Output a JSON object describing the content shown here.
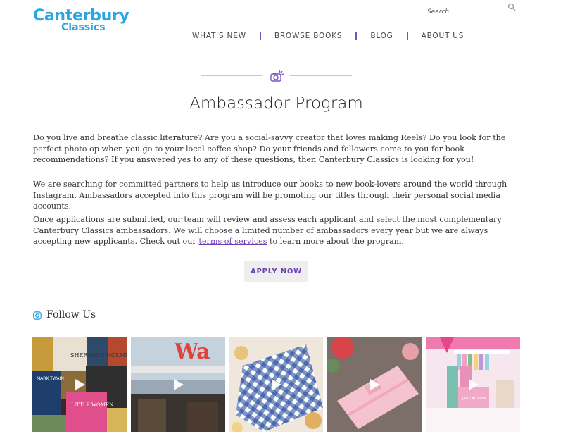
{
  "header": {
    "logo_line1": "Canterbury",
    "logo_line2": "Classics",
    "search_placeholder": "Search",
    "nav": [
      "WHAT'S NEW",
      "BROWSE BOOKS",
      "BLOG",
      "ABOUT US"
    ]
  },
  "main": {
    "title": "Ambassador Program",
    "paragraph1": "Do you live and breathe classic literature? Are you a social-savvy creator that loves making Reels? Do you look for the perfect photo op when you go to your local coffee shop? Do your friends and followers come to you for book recommendations? If you answered yes to any of these questions, then Canterbury Classics is looking for you!",
    "paragraph2": "We are searching for committed partners to help us introduce our books to new book-lovers around the world through Instagram. Ambassadors accepted into this program will be promoting our titles through their personal social media accounts.",
    "paragraph3_before": "Once applications are submitted, our team will review and assess each applicant and select the most complementary Canterbury Classics ambassadors. We will choose a limited number of ambassadors every year but we are always accepting new applicants. Check out our ",
    "paragraph3_link": "terms of services",
    "paragraph3_after": " to learn more about the program.",
    "apply_label": "APPLY NOW"
  },
  "follow": {
    "title": "Follow Us",
    "tiles": [
      {
        "name": "instagram-post-1",
        "book_labels": [
          "SHERLOCK HOLMES",
          "MARK TWAIN",
          "LITTLE WOMEN"
        ]
      },
      {
        "name": "instagram-post-2",
        "sign_text": "Wa"
      },
      {
        "name": "instagram-post-3"
      },
      {
        "name": "instagram-post-4"
      },
      {
        "name": "instagram-post-5",
        "book_label": "JANE AUSTEN"
      }
    ]
  },
  "colors": {
    "brand_blue": "#2aa7e0",
    "accent_purple": "#6c3fb5",
    "nav_separator": "#7a4fc7"
  }
}
